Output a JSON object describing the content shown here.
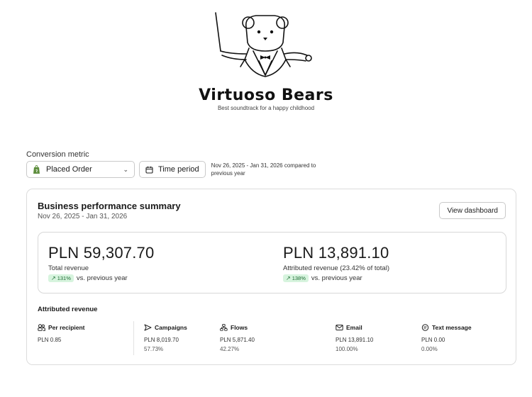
{
  "brand": {
    "name": "Virtuoso Bears",
    "tagline": "Best soundtrack for a happy childhood"
  },
  "conversion_metric": {
    "label": "Conversion metric",
    "selected": "Placed Order",
    "time_period_button": "Time period",
    "period_text": "Nov 26, 2025 - Jan 31, 2026 compared to previous year"
  },
  "summary": {
    "title": "Business performance summary",
    "date_range": "Nov 26, 2025 - Jan 31, 2026",
    "view_dashboard": "View dashboard",
    "total": {
      "value": "PLN 59,307.70",
      "label": "Total revenue",
      "change": "131%",
      "comparison": "vs. previous year"
    },
    "attributed": {
      "value": "PLN 13,891.10",
      "label": "Attributed revenue (23.42% of total)",
      "change": "138%",
      "comparison": "vs. previous year"
    }
  },
  "attributed_revenue": {
    "title": "Attributed revenue",
    "columns": [
      {
        "label": "Per recipient",
        "icon": "users-icon",
        "value": "PLN 0.85",
        "share": ""
      },
      {
        "label": "Campaigns",
        "icon": "send-icon",
        "value": "PLN 8,019.70",
        "share": "57.73%"
      },
      {
        "label": "Flows",
        "icon": "flow-icon",
        "value": "PLN 5,871.40",
        "share": "42.27%"
      },
      {
        "label": "Email",
        "icon": "mail-icon",
        "value": "PLN 13,891.10",
        "share": "100.00%"
      },
      {
        "label": "Text message",
        "icon": "message-icon",
        "value": "PLN 0.00",
        "share": "0.00%"
      }
    ]
  },
  "colors": {
    "pill_bg": "#d7f4de",
    "pill_text": "#1d6b33",
    "shopify_green": "#5e8e3e"
  }
}
